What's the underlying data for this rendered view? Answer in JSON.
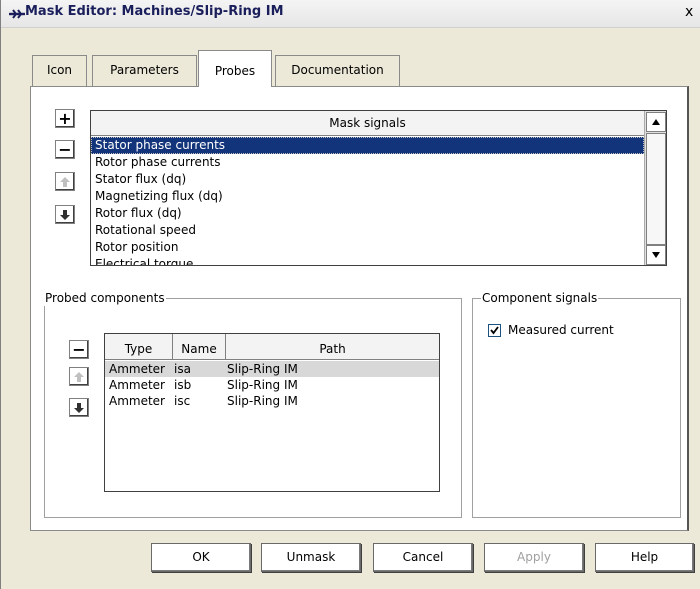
{
  "window": {
    "title": "Mask Editor: Machines/Slip-Ring IM",
    "close_glyph": "x",
    "title_icon": "plecs-icon"
  },
  "tabs": [
    {
      "label": "Icon",
      "active": false
    },
    {
      "label": "Parameters",
      "active": false
    },
    {
      "label": "Probes",
      "active": true
    },
    {
      "label": "Documentation",
      "active": false
    }
  ],
  "mask_signals": {
    "header": "Mask signals",
    "add_label": "+",
    "remove_label": "−",
    "items": [
      "Stator phase currents",
      "Rotor phase currents",
      "Stator flux (dq)",
      "Magnetizing flux (dq)",
      "Rotor flux (dq)",
      "Rotational speed",
      "Rotor position",
      "Electrical torque"
    ],
    "selected_index": 0
  },
  "probed_components": {
    "title": "Probed components",
    "remove_label": "−",
    "columns": [
      "Type",
      "Name",
      "Path"
    ],
    "rows": [
      {
        "type": "Ammeter",
        "name": "isa",
        "path": "Slip-Ring IM"
      },
      {
        "type": "Ammeter",
        "name": "isb",
        "path": "Slip-Ring IM"
      },
      {
        "type": "Ammeter",
        "name": "isc",
        "path": "Slip-Ring IM"
      }
    ],
    "selected_index": 0
  },
  "component_signals": {
    "title": "Component signals",
    "items": [
      {
        "label": "Measured current",
        "checked": true
      }
    ]
  },
  "buttons": {
    "ok": "OK",
    "unmask": "Unmask",
    "cancel": "Cancel",
    "apply": "Apply",
    "help": "Help"
  },
  "colors": {
    "selection": "#12347a",
    "title_text": "#1a1f5c",
    "window_bg": "#ece9d8"
  }
}
